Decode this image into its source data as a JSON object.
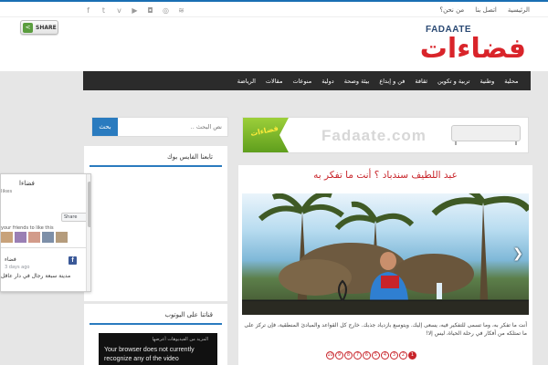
{
  "topbar": {
    "links": [
      "الرئيسية",
      "اتصل بنا",
      "من نحن؟"
    ],
    "social_icons": [
      "facebook-icon",
      "twitter-icon",
      "vimeo-icon",
      "youtube-icon",
      "instagram-icon",
      "dribbble-icon",
      "rss-icon"
    ],
    "social_glyphs": [
      "f",
      "t",
      "v",
      "▶",
      "◘",
      "◎",
      "≋"
    ]
  },
  "header": {
    "share_label": "SHARE",
    "logo_latin": "FADAATE",
    "logo_arabic": "فضاءات"
  },
  "nav": {
    "items": [
      "محلية",
      "وطنية",
      "تربية و تكوين",
      "ثقافة",
      "فن و إبداع",
      "بيئة وصحة",
      "دولية",
      "منوعات",
      "مقالات",
      "الرياضة"
    ]
  },
  "sidebar": {
    "search_button": "بحث",
    "search_placeholder": "نص البحث ..",
    "facebook_widget_title": "تابعنا الفايس بوك",
    "youtube_widget_title": "قناتنا على اليوتوب"
  },
  "facebook_box": {
    "page_name": "فضاءا",
    "likes_text": "likes",
    "share_label": "Share",
    "friends_text": "your friends to like this",
    "post_author": "فضاء",
    "post_time": "3 days ago",
    "post_text": "مدينة سبعة رجال في دار عاقل"
  },
  "youtube_box": {
    "header_text": "المزيد من الفيديوهات أعرضها",
    "message": "Your browser does not currently recognize any of the video"
  },
  "banner": {
    "badge_text": "فضاءات",
    "watermark": "Fadaate.com"
  },
  "article": {
    "title": "عبد اللطيف سندباد ؟ أنت ما تفكر به",
    "excerpt": "أنت ما تفكر به، وما تسمى للتفكير فيه، يسعى إليك. ويتوسع بازدياد جذبك. خارج كل القواعد والمبادئ المنطقية، فإن تركز على ما تمتلكه من أفكار في رحلة الحياة، ليس إلا!",
    "pager": [
      "1",
      "2",
      "3",
      "4",
      "5",
      "6",
      "7",
      "8",
      "9",
      "10"
    ],
    "active_page": "1"
  },
  "colors": {
    "accent": "#2a7bbf",
    "brand_red": "#d9242a",
    "nav_bg": "#2b2b2b"
  }
}
